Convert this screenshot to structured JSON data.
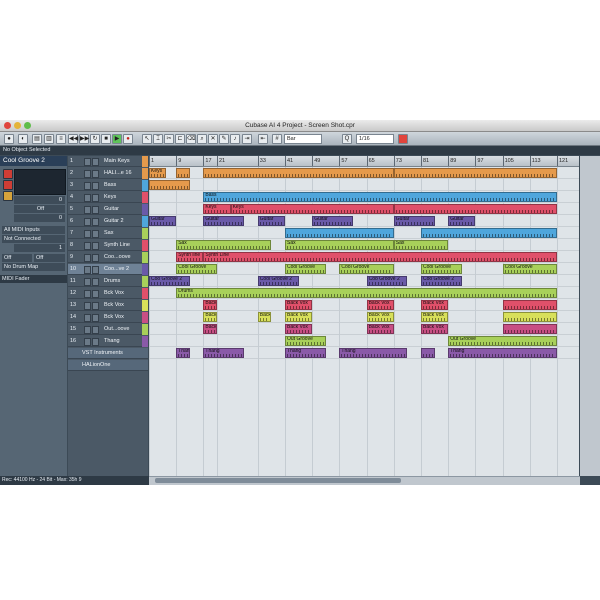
{
  "window": {
    "title": "Cubase AI 4 Project - Screen Shot.cpr",
    "traffic_lights": [
      "#e0443c",
      "#e4b43a",
      "#5fbd4a"
    ]
  },
  "toolbar": {
    "quantize_label": "Bar",
    "grid_label": "1/16"
  },
  "status": {
    "message": "No Object Selected"
  },
  "inspector": {
    "track_title": "Cool Groove 2",
    "volume_value": "0",
    "pan_value": "Off",
    "transpose_value": "0",
    "input": "All MIDI Inputs",
    "output": "Not Connected",
    "channel_value": "1",
    "midi_on": "Off",
    "midi_off": "Off",
    "drum_map": "No Drum Map",
    "midi_fader": "MIDI Fader"
  },
  "tracks": [
    {
      "num": "1",
      "name": "Main Keys",
      "color": "#e59a4c"
    },
    {
      "num": "2",
      "name": "HALI...e 16",
      "color": "#e59a4c"
    },
    {
      "num": "3",
      "name": "Bass",
      "color": "#4fa6dc"
    },
    {
      "num": "4",
      "name": "Keys",
      "color": "#e0506a"
    },
    {
      "num": "5",
      "name": "Guitar",
      "color": "#6a5aa8"
    },
    {
      "num": "6",
      "name": "Guitar 2",
      "color": "#4fa6dc"
    },
    {
      "num": "7",
      "name": "Sax",
      "color": "#a8d05a"
    },
    {
      "num": "8",
      "name": "Synth Line",
      "color": "#e0506a"
    },
    {
      "num": "9",
      "name": "Coo...oove",
      "color": "#a8d05a"
    },
    {
      "num": "10",
      "name": "Coo...ve 2",
      "color": "#6a5aa8"
    },
    {
      "num": "11",
      "name": "Drums",
      "color": "#a8d05a"
    },
    {
      "num": "12",
      "name": "Bck Vox",
      "color": "#e0506a"
    },
    {
      "num": "13",
      "name": "Bck Vox",
      "color": "#d8e05a"
    },
    {
      "num": "14",
      "name": "Bck Vox",
      "color": "#c84f84"
    },
    {
      "num": "15",
      "name": "Out...oove",
      "color": "#a8d05a"
    },
    {
      "num": "16",
      "name": "Thang",
      "color": "#8a5aa8"
    }
  ],
  "folders": [
    {
      "name": "VST Instruments"
    },
    {
      "name": "HALionOne"
    }
  ],
  "ruler": [
    "1",
    "9",
    "17",
    "21",
    "33",
    "41",
    "49",
    "57",
    "65",
    "73",
    "81",
    "89",
    "97",
    "105",
    "113",
    "121"
  ],
  "bottom_status": "Rec: 44100 Hz - 24 Bit - Max: 35h 9",
  "events": [
    {
      "lane": 0,
      "start": 1,
      "end": 6,
      "label": "Keys",
      "color": "#e59a4c"
    },
    {
      "lane": 0,
      "start": 9,
      "end": 13,
      "label": "",
      "color": "#e59a4c"
    },
    {
      "lane": 0,
      "start": 17,
      "end": 73,
      "label": "",
      "color": "#e59a4c"
    },
    {
      "lane": 0,
      "start": 73,
      "end": 121,
      "label": "",
      "color": "#e59a4c"
    },
    {
      "lane": 1,
      "start": 1,
      "end": 13,
      "label": "",
      "color": "#e59a4c"
    },
    {
      "lane": 2,
      "start": 17,
      "end": 121,
      "label": "Bass",
      "color": "#4fa6dc"
    },
    {
      "lane": 3,
      "start": 17,
      "end": 25,
      "label": "Keys",
      "color": "#e0506a"
    },
    {
      "lane": 3,
      "start": 25,
      "end": 73,
      "label": "Keys",
      "color": "#e0506a"
    },
    {
      "lane": 3,
      "start": 73,
      "end": 121,
      "label": "",
      "color": "#e0506a"
    },
    {
      "lane": 4,
      "start": 1,
      "end": 9,
      "label": "Guitar",
      "color": "#6a5aa8"
    },
    {
      "lane": 4,
      "start": 17,
      "end": 29,
      "label": "Guitar",
      "color": "#6a5aa8"
    },
    {
      "lane": 4,
      "start": 33,
      "end": 41,
      "label": "Guitar",
      "color": "#6a5aa8"
    },
    {
      "lane": 4,
      "start": 49,
      "end": 61,
      "label": "Guitar",
      "color": "#6a5aa8"
    },
    {
      "lane": 4,
      "start": 73,
      "end": 85,
      "label": "Guitar",
      "color": "#6a5aa8"
    },
    {
      "lane": 4,
      "start": 89,
      "end": 97,
      "label": "Guitar",
      "color": "#6a5aa8"
    },
    {
      "lane": 5,
      "start": 41,
      "end": 73,
      "label": "",
      "color": "#4fa6dc"
    },
    {
      "lane": 5,
      "start": 81,
      "end": 121,
      "label": "",
      "color": "#4fa6dc"
    },
    {
      "lane": 6,
      "start": 9,
      "end": 37,
      "label": "Sax",
      "color": "#a8d05a"
    },
    {
      "lane": 6,
      "start": 41,
      "end": 73,
      "label": "Sax",
      "color": "#a8d05a"
    },
    {
      "lane": 6,
      "start": 73,
      "end": 89,
      "label": "Sax",
      "color": "#a8d05a"
    },
    {
      "lane": 7,
      "start": 9,
      "end": 17,
      "label": "Synth line",
      "color": "#e0506a"
    },
    {
      "lane": 7,
      "start": 17,
      "end": 121,
      "label": "Synth Line",
      "color": "#e0506a"
    },
    {
      "lane": 8,
      "start": 9,
      "end": 21,
      "label": "Cool Groove",
      "color": "#a8d05a"
    },
    {
      "lane": 8,
      "start": 41,
      "end": 53,
      "label": "Cool Groove",
      "color": "#a8d05a"
    },
    {
      "lane": 8,
      "start": 57,
      "end": 73,
      "label": "Cool Groove",
      "color": "#a8d05a"
    },
    {
      "lane": 8,
      "start": 81,
      "end": 93,
      "label": "Cool Groove",
      "color": "#a8d05a"
    },
    {
      "lane": 8,
      "start": 105,
      "end": 121,
      "label": "Cool Groove",
      "color": "#a8d05a"
    },
    {
      "lane": 9,
      "start": 1,
      "end": 13,
      "label": "Coo Groove 2",
      "color": "#6a5aa8"
    },
    {
      "lane": 9,
      "start": 33,
      "end": 45,
      "label": "Cool Groove 2",
      "color": "#6a5aa8"
    },
    {
      "lane": 9,
      "start": 65,
      "end": 77,
      "label": "Coo Groove 2",
      "color": "#6a5aa8"
    },
    {
      "lane": 9,
      "start": 81,
      "end": 93,
      "label": "Coo Groove 2",
      "color": "#6a5aa8"
    },
    {
      "lane": 10,
      "start": 9,
      "end": 121,
      "label": "Drums",
      "color": "#a8d05a"
    },
    {
      "lane": 11,
      "start": 17,
      "end": 21,
      "label": "Back Vox",
      "color": "#e0506a"
    },
    {
      "lane": 11,
      "start": 41,
      "end": 49,
      "label": "Back Vox",
      "color": "#e0506a"
    },
    {
      "lane": 11,
      "start": 65,
      "end": 73,
      "label": "Back Vox",
      "color": "#e0506a"
    },
    {
      "lane": 11,
      "start": 81,
      "end": 89,
      "label": "Back Vox",
      "color": "#e0506a"
    },
    {
      "lane": 11,
      "start": 105,
      "end": 121,
      "label": "",
      "color": "#e0506a"
    },
    {
      "lane": 12,
      "start": 17,
      "end": 21,
      "label": "Back Vox",
      "color": "#d8e05a"
    },
    {
      "lane": 12,
      "start": 33,
      "end": 37,
      "label": "Back Vox",
      "color": "#d8e05a"
    },
    {
      "lane": 12,
      "start": 41,
      "end": 49,
      "label": "Back Vox",
      "color": "#d8e05a"
    },
    {
      "lane": 12,
      "start": 65,
      "end": 73,
      "label": "Back Vox",
      "color": "#d8e05a"
    },
    {
      "lane": 12,
      "start": 81,
      "end": 89,
      "label": "Back Vox",
      "color": "#d8e05a"
    },
    {
      "lane": 12,
      "start": 105,
      "end": 121,
      "label": "",
      "color": "#d8e05a"
    },
    {
      "lane": 13,
      "start": 17,
      "end": 21,
      "label": "Back Vox",
      "color": "#c84f84"
    },
    {
      "lane": 13,
      "start": 41,
      "end": 49,
      "label": "Back Vox",
      "color": "#c84f84"
    },
    {
      "lane": 13,
      "start": 65,
      "end": 73,
      "label": "Back Vox",
      "color": "#c84f84"
    },
    {
      "lane": 13,
      "start": 81,
      "end": 89,
      "label": "Back Vox",
      "color": "#c84f84"
    },
    {
      "lane": 13,
      "start": 105,
      "end": 121,
      "label": "",
      "color": "#c84f84"
    },
    {
      "lane": 14,
      "start": 41,
      "end": 53,
      "label": "Out Groove",
      "color": "#a8d05a"
    },
    {
      "lane": 14,
      "start": 89,
      "end": 121,
      "label": "Out Groove",
      "color": "#a8d05a"
    },
    {
      "lane": 15,
      "start": 9,
      "end": 13,
      "label": "Thang",
      "color": "#8a5aa8"
    },
    {
      "lane": 15,
      "start": 17,
      "end": 29,
      "label": "Thang",
      "color": "#8a5aa8"
    },
    {
      "lane": 15,
      "start": 41,
      "end": 53,
      "label": "Thang",
      "color": "#8a5aa8"
    },
    {
      "lane": 15,
      "start": 57,
      "end": 77,
      "label": "Thang",
      "color": "#8a5aa8"
    },
    {
      "lane": 15,
      "start": 81,
      "end": 85,
      "label": "",
      "color": "#8a5aa8"
    },
    {
      "lane": 15,
      "start": 89,
      "end": 121,
      "label": "Thang",
      "color": "#8a5aa8"
    }
  ]
}
